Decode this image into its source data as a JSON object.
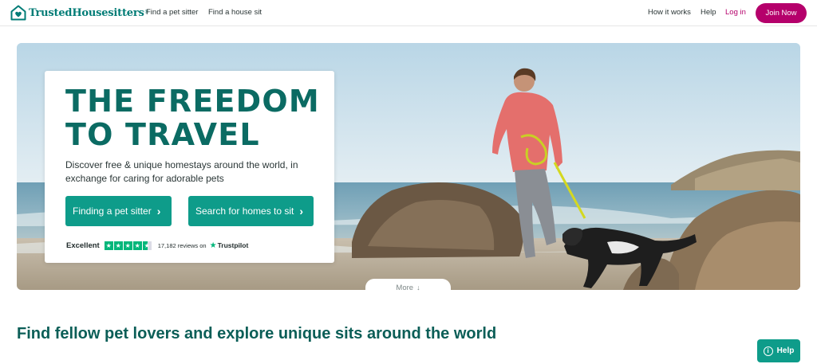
{
  "brand": {
    "name": "TrustedHousesitters",
    "registered_mark": "®",
    "color": "#007c76",
    "logo_icon": "house-heart-icon"
  },
  "nav": {
    "left_links": [
      "Find a pet sitter",
      "Find a house sit"
    ],
    "right_links": [
      "How it works",
      "Help"
    ],
    "login_label": "Log in",
    "join_label": "Join Now",
    "accent": "#b5006b"
  },
  "hero": {
    "headline_line1": "THE FREEDOM",
    "headline_line2": "TO TRAVEL",
    "subtext": "Discover free & unique homestays around the world, in exchange for caring for adorable pets",
    "cta_primary": "Finding a pet sitter",
    "cta_secondary": "Search for homes to sit",
    "cta_icon": "chevron-right-icon",
    "cta_color": "#0e9c8a",
    "headline_color": "#0b6b63",
    "image_description_icon": "hero-photo-woman-dog-beach",
    "trustpilot": {
      "rating_label": "Excellent",
      "stars": 4.5,
      "reviews_text": "17,182 reviews on",
      "brand": "Trustpilot",
      "star_color": "#00b67a"
    },
    "more_label": "More",
    "more_icon": "arrow-down-icon"
  },
  "section": {
    "title": "Find fellow pet lovers and explore unique sits around the world"
  },
  "help_widget": {
    "label": "Help",
    "icon": "info-icon"
  }
}
